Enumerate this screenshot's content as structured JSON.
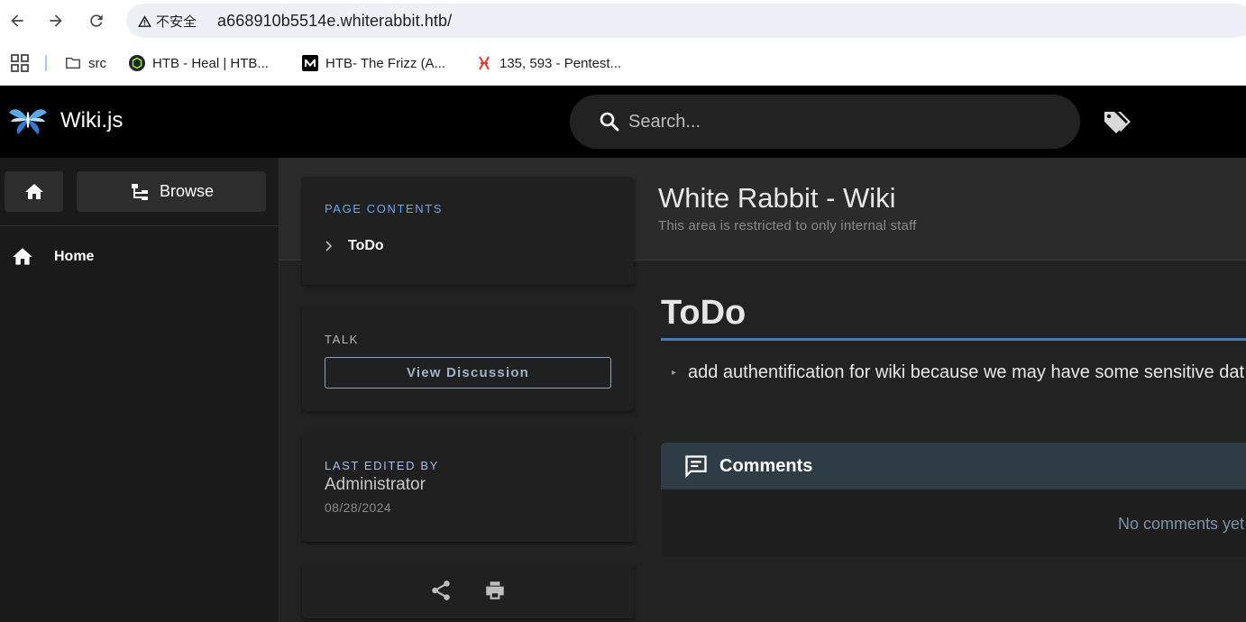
{
  "browser": {
    "security_label": "不安全",
    "url": "a668910b5514e.whiterabbit.htb/",
    "bookmarks": [
      {
        "label": "src",
        "icon": "folder-icon"
      },
      {
        "label": "HTB - Heal | HTB...",
        "icon": "htb-favicon"
      },
      {
        "label": "HTB- The Frizz (A...",
        "icon": "medium-favicon"
      },
      {
        "label": "135, 593 - Pentest...",
        "icon": "hacktricks-favicon"
      }
    ]
  },
  "header": {
    "brand": "Wiki.js",
    "search_placeholder": "Search..."
  },
  "leftnav": {
    "browse_label": "Browse",
    "items": [
      {
        "label": "Home",
        "icon": "home-icon"
      }
    ]
  },
  "page": {
    "title": "White Rabbit - Wiki",
    "description": "This area is restricted to only internal staff"
  },
  "toc": {
    "label": "PAGE CONTENTS",
    "items": [
      "ToDo"
    ]
  },
  "talk": {
    "label": "TALK",
    "button_label": "View Discussion"
  },
  "last_edited": {
    "label": "LAST EDITED BY",
    "name": "Administrator",
    "date": "08/28/2024"
  },
  "content": {
    "heading": "ToDo",
    "items": [
      "add authentification for wiki because we may have some sensitive dat"
    ]
  },
  "comments": {
    "title": "Comments",
    "empty_text": "No comments yet"
  },
  "colors": {
    "accent": "#2f7fd8",
    "toc_label": "#64a8f0",
    "edited_label": "#a8bde6",
    "comments_header": "#2e3c45"
  }
}
